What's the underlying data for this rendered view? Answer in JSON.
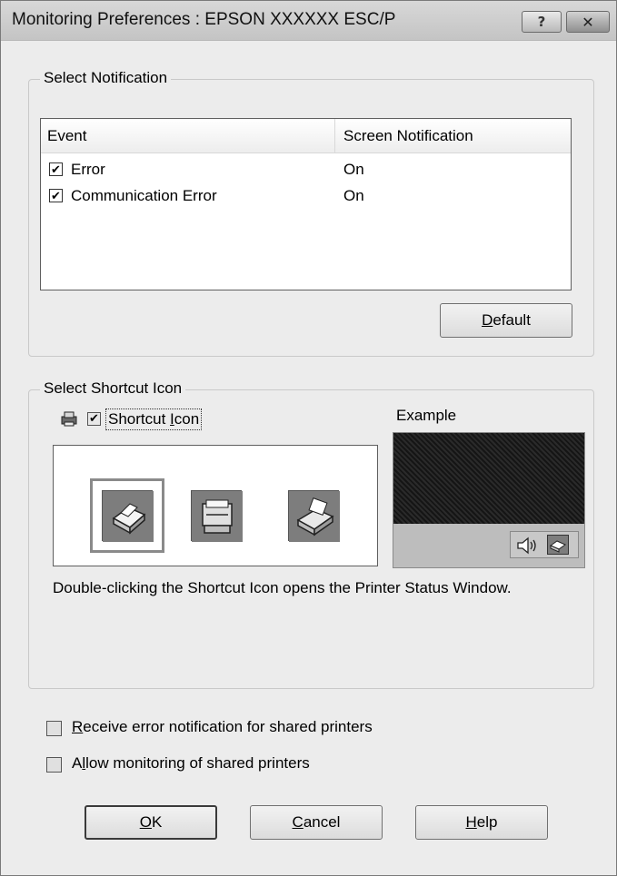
{
  "window": {
    "title": "Monitoring Preferences : EPSON XXXXXX ESC/P",
    "help_glyph": "?",
    "close_glyph": "✕"
  },
  "notification": {
    "group_title": "Select Notification",
    "columns": [
      "Event",
      "Screen Notification"
    ],
    "rows": [
      {
        "event": "Error",
        "checked": true,
        "value": "On"
      },
      {
        "event": "Communication Error",
        "checked": true,
        "value": "On"
      }
    ],
    "default_prefix": "",
    "default_mnemonic": "D",
    "default_rest": "efault"
  },
  "shortcut": {
    "group_title": "Select Shortcut Icon",
    "checkbox_checked": true,
    "label_prefix": "Shortcut ",
    "label_mnemonic": "I",
    "label_rest": "con",
    "example_label": "Example",
    "description": "Double-clicking the Shortcut Icon opens the Printer Status Window.",
    "icons": [
      "printer-icon-1",
      "printer-icon-2",
      "printer-icon-3"
    ]
  },
  "options": {
    "receive_error_mnemonic": "R",
    "receive_error_rest": "eceive error notification for shared printers",
    "allow_monitoring_prefix": "A",
    "allow_monitoring_mnemonic": "l",
    "allow_monitoring_rest": "low monitoring of shared printers"
  },
  "buttons": {
    "ok_mnemonic": "O",
    "ok_rest": "K",
    "cancel_mnemonic": "C",
    "cancel_rest": "ancel",
    "help_mnemonic": "H",
    "help_rest": "elp"
  },
  "colors": {
    "dialog_bg": "#ececec",
    "titlebar": "#cfcfcf",
    "example_dark": "#1c1c1c",
    "example_bar": "#bdbdbd"
  }
}
